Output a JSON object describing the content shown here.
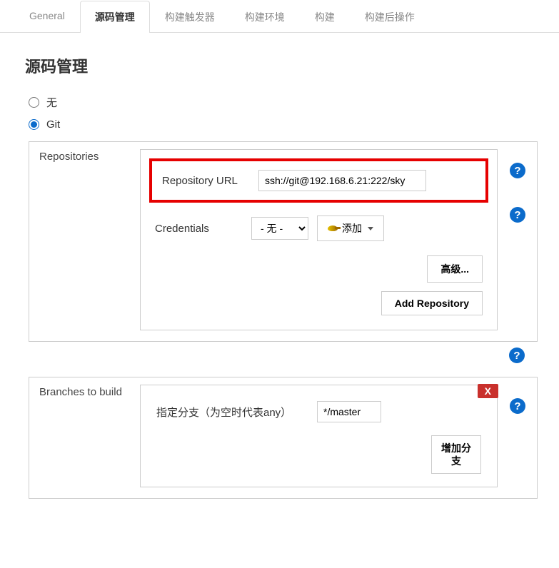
{
  "tabs": {
    "general": "General",
    "scm": "源码管理",
    "triggers": "构建触发器",
    "env": "构建环境",
    "build": "构建",
    "post": "构建后操作"
  },
  "section_title": "源码管理",
  "radios": {
    "none": "无",
    "git": "Git"
  },
  "repositories": {
    "label": "Repositories",
    "url_label": "Repository URL",
    "url_value": "ssh://git@192.168.6.21:222/sky",
    "credentials_label": "Credentials",
    "credentials_selected": "- 无 -",
    "add_label": "添加",
    "advanced": "高级...",
    "add_repo": "Add Repository"
  },
  "branches": {
    "label": "Branches to build",
    "spec_label": "指定分支（为空时代表any）",
    "spec_value": "*/master",
    "add_branch": "增加分支",
    "close": "X"
  },
  "help": "?"
}
